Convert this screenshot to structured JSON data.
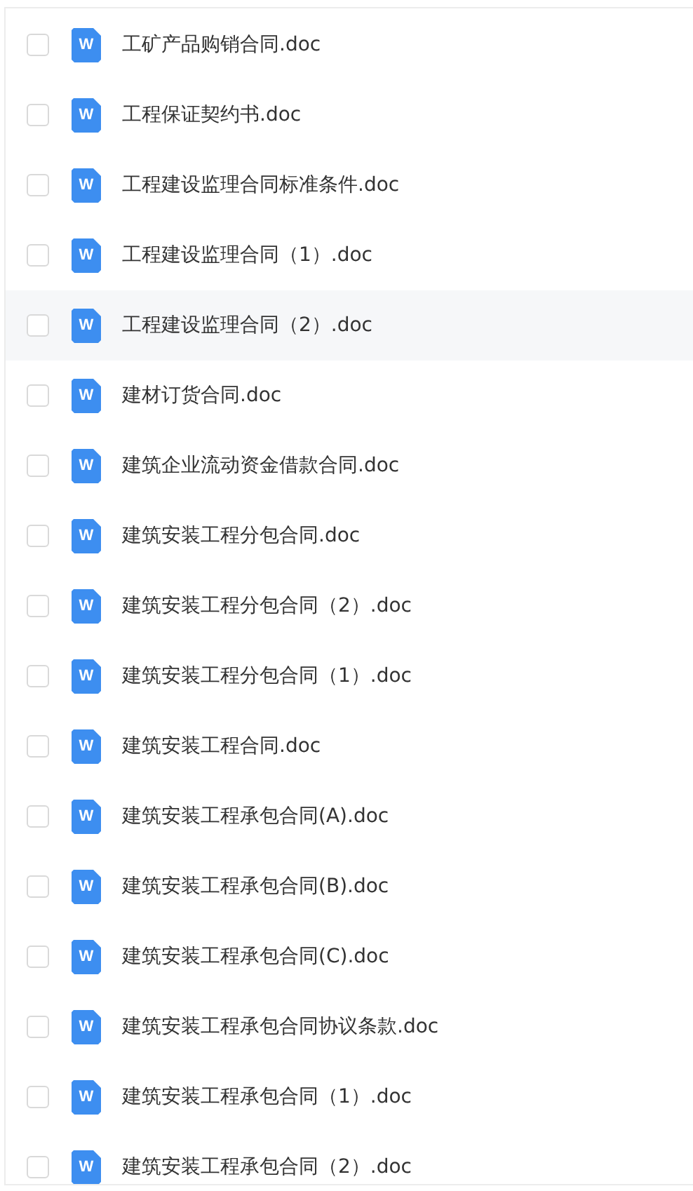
{
  "files": [
    {
      "name": "工矿产品购销合同.doc",
      "icon_letter": "W",
      "checked": false,
      "highlighted": false
    },
    {
      "name": "工程保证契约书.doc",
      "icon_letter": "W",
      "checked": false,
      "highlighted": false
    },
    {
      "name": "工程建设监理合同标准条件.doc",
      "icon_letter": "W",
      "checked": false,
      "highlighted": false
    },
    {
      "name": "工程建设监理合同（1）.doc",
      "icon_letter": "W",
      "checked": false,
      "highlighted": false
    },
    {
      "name": "工程建设监理合同（2）.doc",
      "icon_letter": "W",
      "checked": false,
      "highlighted": true
    },
    {
      "name": "建材订货合同.doc",
      "icon_letter": "W",
      "checked": false,
      "highlighted": false
    },
    {
      "name": "建筑企业流动资金借款合同.doc",
      "icon_letter": "W",
      "checked": false,
      "highlighted": false
    },
    {
      "name": "建筑安装工程分包合同.doc",
      "icon_letter": "W",
      "checked": false,
      "highlighted": false
    },
    {
      "name": "建筑安装工程分包合同（2）.doc",
      "icon_letter": "W",
      "checked": false,
      "highlighted": false
    },
    {
      "name": "建筑安装工程分包合同（1）.doc",
      "icon_letter": "W",
      "checked": false,
      "highlighted": false
    },
    {
      "name": "建筑安装工程合同.doc",
      "icon_letter": "W",
      "checked": false,
      "highlighted": false
    },
    {
      "name": "建筑安装工程承包合同(A).doc",
      "icon_letter": "W",
      "checked": false,
      "highlighted": false
    },
    {
      "name": "建筑安装工程承包合同(B).doc",
      "icon_letter": "W",
      "checked": false,
      "highlighted": false
    },
    {
      "name": "建筑安装工程承包合同(C).doc",
      "icon_letter": "W",
      "checked": false,
      "highlighted": false
    },
    {
      "name": "建筑安装工程承包合同协议条款.doc",
      "icon_letter": "W",
      "checked": false,
      "highlighted": false
    },
    {
      "name": "建筑安装工程承包合同（1）.doc",
      "icon_letter": "W",
      "checked": false,
      "highlighted": false
    },
    {
      "name": "建筑安装工程承包合同（2）.doc",
      "icon_letter": "W",
      "checked": false,
      "highlighted": false
    }
  ]
}
